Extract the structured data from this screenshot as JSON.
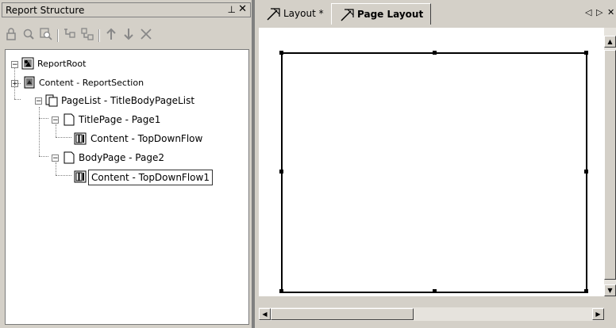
{
  "panel": {
    "title": "Report Structure",
    "pin_glyph": "⊥",
    "close_glyph": "✕"
  },
  "toolbar": [
    {
      "name": "lock-icon",
      "glyph": "🔒"
    },
    {
      "name": "find-icon",
      "glyph": "🔍"
    },
    {
      "name": "find-report-icon",
      "glyph": "🔎"
    },
    {
      "name": "move-up-level-icon",
      "glyph": "⇱"
    },
    {
      "name": "move-down-level-icon",
      "glyph": "⇲"
    },
    {
      "name": "move-up-icon",
      "glyph": "↑"
    },
    {
      "name": "move-down-icon",
      "glyph": "↓"
    },
    {
      "name": "delete-icon",
      "glyph": "✕"
    }
  ],
  "tree": {
    "root": "ReportRoot",
    "content_section": "Content - ReportSection",
    "pagelist": "PageList - TitleBodyPageList",
    "titlepage": "TitlePage - Page1",
    "titlepage_content": "Content - TopDownFlow",
    "bodypage": "BodyPage - Page2",
    "bodypage_content": "Content - TopDownFlow1"
  },
  "tabs": {
    "layout": "Layout *",
    "page_layout": "Page Layout *",
    "prev_glyph": "◁",
    "next_glyph": "▷",
    "close_glyph": "✕"
  },
  "colors": {
    "chrome": "#d4d0c8",
    "border_dark": "#808080",
    "canvas": "#ffffff"
  }
}
